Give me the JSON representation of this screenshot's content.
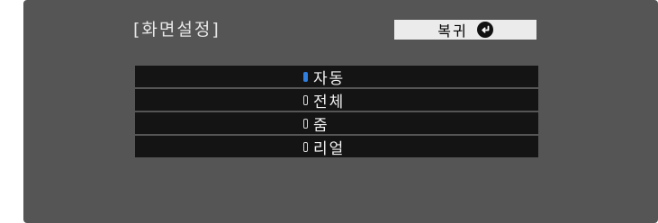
{
  "screen": {
    "title": "[화면설정]",
    "return_label": "복귀",
    "return_icon": "return-arrow-icon"
  },
  "options": [
    {
      "label": "자동",
      "selected": true
    },
    {
      "label": "전체",
      "selected": false
    },
    {
      "label": "줌",
      "selected": false
    },
    {
      "label": "리얼",
      "selected": false
    }
  ],
  "colors": {
    "background": "#555555",
    "row": "#141414",
    "selected_radio": "#2f7fe0",
    "return_button": "#ebebeb"
  }
}
